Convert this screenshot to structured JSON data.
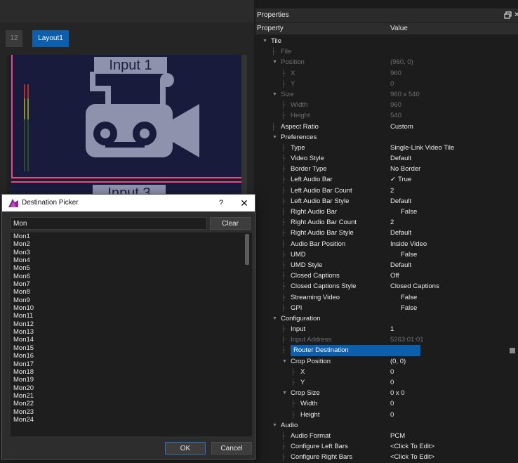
{
  "layout": {
    "tabs": [
      {
        "label": "12"
      },
      {
        "label": "Layout1"
      }
    ],
    "tiles": [
      {
        "label": "Input 1"
      },
      {
        "label": "Input 3"
      }
    ],
    "tile_small_caption": "Input 1"
  },
  "colors": {
    "accent": "#0d5fae",
    "tile_border": "#e64a8a",
    "tile_bg": "#191b3c",
    "icon_fill": "#8e92ad",
    "panel_bg": "#1c1c1c"
  },
  "dialog": {
    "title": "Destination Picker",
    "help": "?",
    "close": "✕",
    "search_value": "Mon",
    "clear_label": "Clear",
    "destinations": [
      "Mon1",
      "Mon2",
      "Mon3",
      "Mon4",
      "Mon5",
      "Mon6",
      "Mon7",
      "Mon8",
      "Mon9",
      "Mon10",
      "Mon11",
      "Mon12",
      "Mon13",
      "Mon14",
      "Mon15",
      "Mon16",
      "Mon17",
      "Mon18",
      "Mon19",
      "Mon20",
      "Mon21",
      "Mon22",
      "Mon23",
      "Mon24"
    ],
    "ok_label": "OK",
    "cancel_label": "Cancel"
  },
  "properties": {
    "title": "Properties",
    "close": "✕",
    "col_property": "Property",
    "col_value": "Value",
    "rows": [
      {
        "label": "Tile",
        "value": "",
        "level": 0,
        "expander": true,
        "state": "lit"
      },
      {
        "label": "File",
        "value": "",
        "level": 1,
        "expander": false,
        "state": "dim"
      },
      {
        "label": "Position",
        "value": "(960, 0)",
        "level": 1,
        "expander": true,
        "state": "dim"
      },
      {
        "label": "X",
        "value": "960",
        "level": 2,
        "expander": false,
        "state": "dim"
      },
      {
        "label": "Y",
        "value": "0",
        "level": 2,
        "expander": false,
        "state": "dim"
      },
      {
        "label": "Size",
        "value": "960 x 540",
        "level": 1,
        "expander": true,
        "state": "dim"
      },
      {
        "label": "Width",
        "value": "960",
        "level": 2,
        "expander": false,
        "state": "dim"
      },
      {
        "label": "Height",
        "value": "540",
        "level": 2,
        "expander": false,
        "state": "dim"
      },
      {
        "label": "Aspect Ratio",
        "value": "Custom",
        "level": 1,
        "expander": false,
        "state": "lit"
      },
      {
        "label": "Preferences",
        "value": "",
        "level": 1,
        "expander": true,
        "state": "lit"
      },
      {
        "label": "Type",
        "value": "Single-Link Video Tile",
        "level": 2,
        "expander": false,
        "state": "lit"
      },
      {
        "label": "Video Style",
        "value": "Default",
        "level": 2,
        "expander": false,
        "state": "lit"
      },
      {
        "label": "Border Type",
        "value": "No Border",
        "level": 2,
        "expander": false,
        "state": "lit"
      },
      {
        "label": "Left Audio Bar",
        "value": "True",
        "level": 2,
        "expander": false,
        "state": "lit",
        "bool": true
      },
      {
        "label": "Left Audio Bar Count",
        "value": "2",
        "level": 2,
        "expander": false,
        "state": "lit"
      },
      {
        "label": "Left Audio Bar Style",
        "value": "Default",
        "level": 2,
        "expander": false,
        "state": "lit"
      },
      {
        "label": "Right Audio Bar",
        "value": "False",
        "level": 2,
        "expander": false,
        "state": "lit",
        "bool": false
      },
      {
        "label": "Right Audio Bar Count",
        "value": "2",
        "level": 2,
        "expander": false,
        "state": "lit"
      },
      {
        "label": "Right Audio Bar Style",
        "value": "Default",
        "level": 2,
        "expander": false,
        "state": "lit"
      },
      {
        "label": "Audio Bar Position",
        "value": "Inside Video",
        "level": 2,
        "expander": false,
        "state": "lit"
      },
      {
        "label": "UMD",
        "value": "False",
        "level": 2,
        "expander": false,
        "state": "lit",
        "bool": false
      },
      {
        "label": "UMD Style",
        "value": "Default",
        "level": 2,
        "expander": false,
        "state": "lit"
      },
      {
        "label": "Closed Captions",
        "value": "Off",
        "level": 2,
        "expander": false,
        "state": "lit"
      },
      {
        "label": "Closed Captions Style",
        "value": "Closed Captions",
        "level": 2,
        "expander": false,
        "state": "lit"
      },
      {
        "label": "Streaming Video",
        "value": "False",
        "level": 2,
        "expander": false,
        "state": "lit",
        "bool": false
      },
      {
        "label": "GPI",
        "value": "False",
        "level": 2,
        "expander": false,
        "state": "lit",
        "bool": false
      },
      {
        "label": "Configuration",
        "value": "",
        "level": 1,
        "expander": true,
        "state": "lit"
      },
      {
        "label": "Input",
        "value": "1",
        "level": 2,
        "expander": false,
        "state": "lit"
      },
      {
        "label": "Input Address",
        "value": "5263:01:01",
        "level": 2,
        "expander": false,
        "state": "dim"
      },
      {
        "label": "Router Destination",
        "value": "",
        "level": 2,
        "expander": false,
        "state": "lit",
        "selected": true
      },
      {
        "label": "Crop Position",
        "value": "(0, 0)",
        "level": 2,
        "expander": true,
        "state": "lit"
      },
      {
        "label": "X",
        "value": "0",
        "level": 3,
        "expander": false,
        "state": "lit"
      },
      {
        "label": "Y",
        "value": "0",
        "level": 3,
        "expander": false,
        "state": "lit"
      },
      {
        "label": "Crop Size",
        "value": "0 x 0",
        "level": 2,
        "expander": true,
        "state": "lit"
      },
      {
        "label": "Width",
        "value": "0",
        "level": 3,
        "expander": false,
        "state": "lit"
      },
      {
        "label": "Height",
        "value": "0",
        "level": 3,
        "expander": false,
        "state": "lit"
      },
      {
        "label": "Audio",
        "value": "",
        "level": 1,
        "expander": true,
        "state": "lit"
      },
      {
        "label": "Audio Format",
        "value": "PCM",
        "level": 2,
        "expander": false,
        "state": "lit"
      },
      {
        "label": "Configure Left Bars",
        "value": "<Click To Edit>",
        "level": 2,
        "expander": false,
        "state": "lit"
      },
      {
        "label": "Configure Right Bars",
        "value": "<Click To Edit>",
        "level": 2,
        "expander": false,
        "state": "lit"
      }
    ]
  }
}
